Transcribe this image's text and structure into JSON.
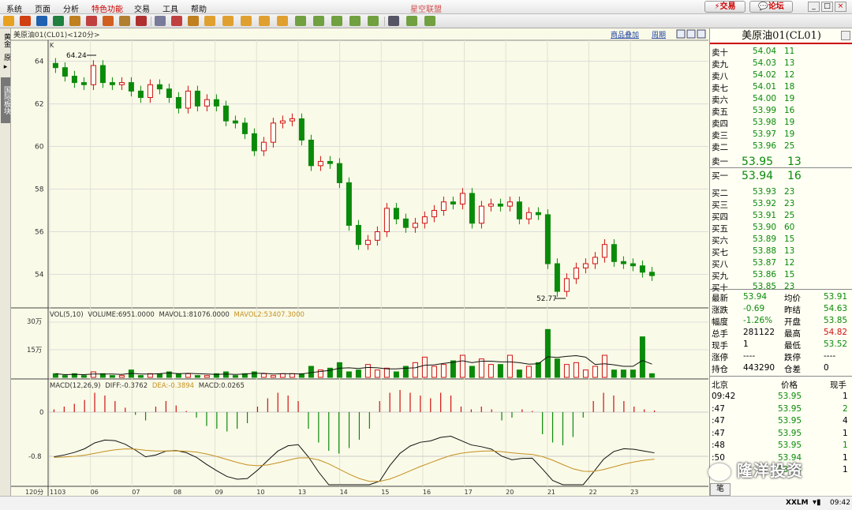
{
  "app": {
    "title": "星空联盟",
    "menu": [
      "系统",
      "页面",
      "分析",
      "特色功能",
      "交易",
      "工具",
      "帮助"
    ],
    "trade_button": "交易",
    "forum_button": "论坛",
    "window_buttons": [
      "_",
      "□",
      "×"
    ]
  },
  "colors": {
    "up": "#d01010",
    "down": "#0a8a0a",
    "accent_line": "#c39020"
  },
  "toolbar": {
    "icons": [
      "back-arrow-icon",
      "home-icon",
      "quote-list-icon",
      "refresh-icon",
      "zoom-in-icon",
      "zoom-out-icon",
      "chart-icon",
      "hand-icon",
      "filter-icon",
      "table-icon",
      "drawing-icon",
      "fx-icon",
      "calendar-icon",
      "day-icon",
      "week-icon",
      "month-icon",
      "year-icon",
      "period-1-icon",
      "period-5-icon",
      "period-15-icon",
      "period-30-icon",
      "period-60-icon",
      "kline-icon",
      "multi-day-icon",
      "tick-icon"
    ]
  },
  "left_tabs": [
    "黄金",
    "原",
    "▸",
    "国际板块"
  ],
  "chart": {
    "header_title": "美原油01(CL01)<120分>",
    "compare_link": "商品叠加",
    "cycle_link": "周期",
    "k_label": "K",
    "price_axis": [
      "64",
      "62",
      "60",
      "58",
      "56",
      "54"
    ],
    "high_label": "64.24",
    "low_label": "52.77",
    "volume_header": {
      "name": "VOL(5,10)",
      "volume": "VOLUME:6951.0000",
      "mavol1": "MAVOL1:81076.0000",
      "mavol2": "MAVOL2:53407.3000"
    },
    "volume_axis": [
      "30万",
      "15万"
    ],
    "macd_header": {
      "name": "MACD(12,26,9)",
      "diff": "DIFF:-0.3762",
      "dea": "DEA:-0.3894",
      "macd": "MACD:0.0265"
    },
    "macd_axis": [
      "0",
      "-0.8"
    ],
    "period_label": "120分",
    "x_ticks": [
      "1103",
      "06",
      "07",
      "08",
      "09",
      "10",
      "13",
      "14",
      "15",
      "16",
      "17",
      "20",
      "21",
      "22",
      "23"
    ]
  },
  "quote": {
    "title": "美原油01(CL01)",
    "asks": [
      [
        "卖十",
        "54.04",
        "11"
      ],
      [
        "卖九",
        "54.03",
        "13"
      ],
      [
        "卖八",
        "54.02",
        "12"
      ],
      [
        "卖七",
        "54.01",
        "18"
      ],
      [
        "卖六",
        "54.00",
        "19"
      ],
      [
        "卖五",
        "53.99",
        "16"
      ],
      [
        "卖四",
        "53.98",
        "19"
      ],
      [
        "卖三",
        "53.97",
        "19"
      ],
      [
        "卖二",
        "53.96",
        "25"
      ],
      [
        "卖一",
        "53.95",
        "13"
      ]
    ],
    "bids": [
      [
        "买一",
        "53.94",
        "16"
      ],
      [
        "买二",
        "53.93",
        "23"
      ],
      [
        "买三",
        "53.92",
        "23"
      ],
      [
        "买四",
        "53.91",
        "25"
      ],
      [
        "买五",
        "53.90",
        "60"
      ],
      [
        "买六",
        "53.89",
        "15"
      ],
      [
        "买七",
        "53.88",
        "13"
      ],
      [
        "买八",
        "53.87",
        "12"
      ],
      [
        "买九",
        "53.86",
        "15"
      ],
      [
        "买十",
        "53.85",
        "23"
      ]
    ],
    "stats": [
      [
        "最新",
        "53.94",
        "均价",
        "53.91"
      ],
      [
        "涨跌",
        "-0.69",
        "昨结",
        "54.63"
      ],
      [
        "幅度",
        "-1.26%",
        "开盘",
        "53.85"
      ],
      [
        "总手",
        "281122",
        "最高",
        "54.82"
      ],
      [
        "现手",
        "1",
        "最低",
        "53.52"
      ],
      [
        "涨停",
        "----",
        "跌停",
        "----"
      ],
      [
        "持仓",
        "443290",
        "仓差",
        "0"
      ]
    ],
    "ticks_header": [
      "北京",
      "价格",
      "现手"
    ],
    "ticks": [
      [
        "09:42",
        "53.95",
        "1"
      ],
      [
        ":47",
        "53.95",
        "2"
      ],
      [
        ":47",
        "53.95",
        "4"
      ],
      [
        ":47",
        "53.95",
        "1"
      ],
      [
        ":48",
        "53.95",
        "1"
      ],
      [
        ":50",
        "53.94",
        "1"
      ],
      [
        "",
        "53.94",
        "1"
      ]
    ],
    "bottom_tab": "笔"
  },
  "status": {
    "brand": "XXLM",
    "time": "09:42"
  },
  "watermark": "隆洋投资",
  "chart_data": {
    "type": "candlestick",
    "title": "美原油01(CL01)<120分>",
    "ylim": [
      52.5,
      64.8
    ],
    "x_categories": [
      "1103",
      "06",
      "07",
      "08",
      "09",
      "10",
      "13",
      "14",
      "15",
      "16",
      "17",
      "20",
      "21",
      "22",
      "23"
    ],
    "series": [
      {
        "name": "K",
        "values": [
          63.7,
          63.3,
          63.0,
          62.9,
          63.8,
          63.0,
          62.9,
          63.0,
          62.6,
          62.3,
          62.9,
          62.7,
          62.3,
          61.8,
          62.6,
          61.9,
          62.2,
          61.9,
          61.2,
          61.1,
          60.6,
          59.8,
          60.2,
          61.1,
          61.2,
          61.3,
          60.3,
          59.1,
          59.3,
          59.2,
          58.3,
          56.3,
          55.4,
          55.6,
          56.0,
          57.1,
          56.6,
          56.2,
          56.4,
          56.7,
          57.0,
          57.4,
          57.3,
          57.8,
          56.4,
          57.2,
          57.3,
          57.2,
          57.4,
          56.6,
          56.9,
          56.8,
          54.5,
          53.2,
          53.8,
          54.3,
          54.5,
          54.8,
          55.4,
          54.6,
          54.5,
          54.4,
          54.1,
          53.94
        ]
      },
      {
        "name": "VOL",
        "values": [
          2,
          1,
          2,
          1,
          3,
          2,
          1,
          1,
          4,
          1,
          2,
          2,
          3,
          2,
          2,
          1,
          1,
          2,
          3,
          1,
          2,
          3,
          2,
          1,
          2,
          2,
          2,
          6,
          4,
          5,
          8,
          3,
          4,
          7,
          4,
          5,
          3,
          6,
          8,
          11,
          6,
          7,
          9,
          12,
          6,
          10,
          7,
          7,
          12,
          4,
          6,
          8,
          26,
          10,
          7,
          8,
          4,
          6,
          12,
          4,
          4,
          4,
          22,
          2
        ]
      },
      {
        "name": "MACD",
        "values": [
          0.05,
          0.1,
          0.15,
          0.22,
          0.35,
          0.3,
          0.2,
          0.08,
          -0.05,
          -0.15,
          0.1,
          0.2,
          0.12,
          0.02,
          -0.1,
          -0.25,
          -0.3,
          -0.35,
          -0.3,
          -0.2,
          0.1,
          0.25,
          0.35,
          0.3,
          0.2,
          -0.3,
          -0.55,
          -0.7,
          -0.75,
          -0.65,
          -0.5,
          -0.3,
          0.2,
          0.35,
          0.4,
          0.35,
          0.3,
          0.25,
          0.35,
          0.3,
          0.1,
          0.05,
          0.1,
          0.05,
          -0.15,
          -0.1,
          0.05,
          0.02,
          -0.4,
          -0.55,
          -0.6,
          -0.45,
          -0.1,
          0.2,
          0.35,
          0.3,
          0.2,
          0.1,
          0.05,
          0.03
        ]
      }
    ]
  }
}
